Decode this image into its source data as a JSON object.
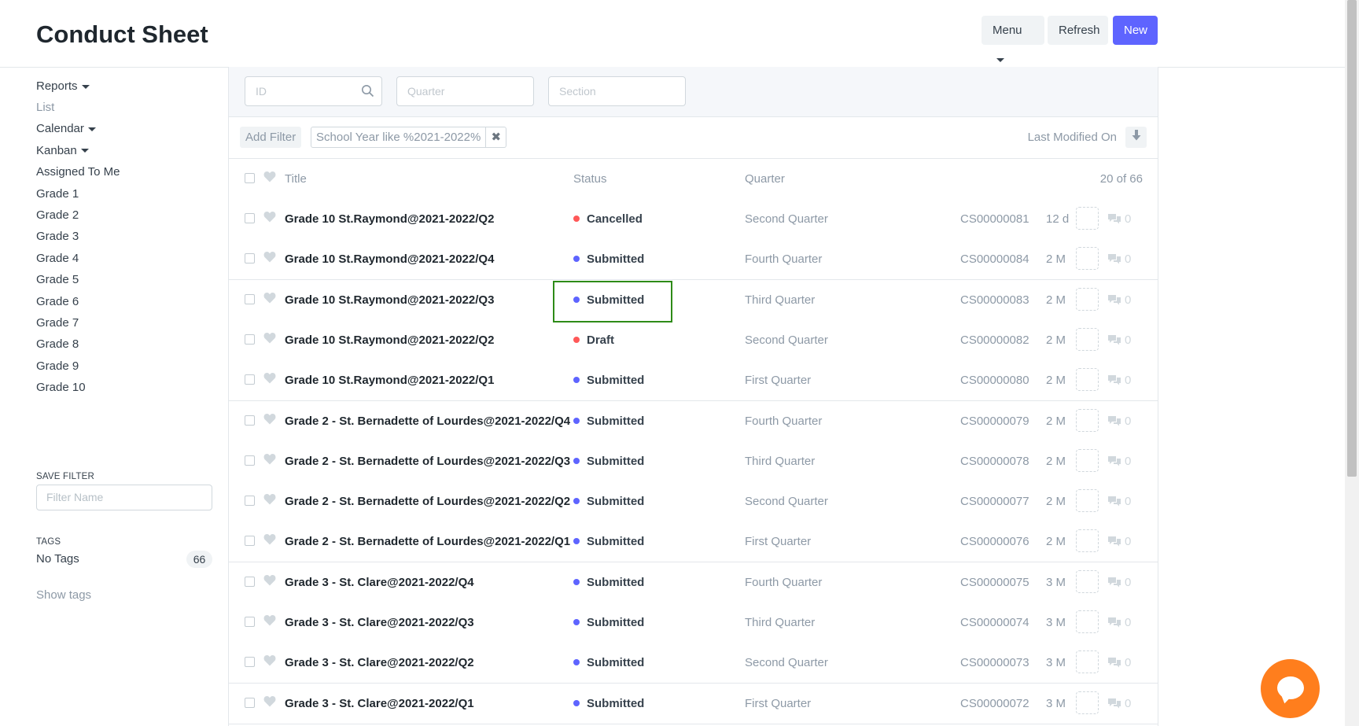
{
  "header": {
    "title": "Conduct Sheet",
    "menu_label": "Menu",
    "refresh_label": "Refresh",
    "new_label": "New"
  },
  "sidebar": {
    "items": [
      {
        "label": "Reports",
        "dropdown": true,
        "muted": false
      },
      {
        "label": "List",
        "dropdown": false,
        "muted": true
      },
      {
        "label": "Calendar",
        "dropdown": true,
        "muted": false
      },
      {
        "label": "Kanban",
        "dropdown": true,
        "muted": false
      },
      {
        "label": "Assigned To Me",
        "dropdown": false,
        "muted": false
      },
      {
        "label": "Grade 1",
        "dropdown": false,
        "muted": false
      },
      {
        "label": "Grade 2",
        "dropdown": false,
        "muted": false
      },
      {
        "label": "Grade 3",
        "dropdown": false,
        "muted": false
      },
      {
        "label": "Grade 4",
        "dropdown": false,
        "muted": false
      },
      {
        "label": "Grade 5",
        "dropdown": false,
        "muted": false
      },
      {
        "label": "Grade 6",
        "dropdown": false,
        "muted": false
      },
      {
        "label": "Grade 7",
        "dropdown": false,
        "muted": false
      },
      {
        "label": "Grade 8",
        "dropdown": false,
        "muted": false
      },
      {
        "label": "Grade 9",
        "dropdown": false,
        "muted": false
      },
      {
        "label": "Grade 10",
        "dropdown": false,
        "muted": false
      }
    ],
    "save_filter_heading": "SAVE FILTER",
    "filter_name_placeholder": "Filter Name",
    "tags_heading": "TAGS",
    "no_tags_label": "No Tags",
    "no_tags_count": "66",
    "show_tags_label": "Show tags"
  },
  "filters": {
    "id_placeholder": "ID",
    "quarter_placeholder": "Quarter",
    "section_placeholder": "Section",
    "add_filter_label": "Add Filter",
    "active_filter": "School Year like %2021-2022%",
    "sort_label": "Last Modified On"
  },
  "list_header": {
    "title": "Title",
    "status": "Status",
    "quarter": "Quarter",
    "count": "20 of 66"
  },
  "status_colors": {
    "Cancelled": "#ff5858",
    "Draft": "#ff5858",
    "Submitted": "#5e64ff"
  },
  "rows": [
    {
      "title": "Grade 10 St.Raymond@2021-2022/Q2",
      "status": "Cancelled",
      "quarter": "Second Quarter",
      "id": "CS00000081",
      "modified": "12 d",
      "comments": "0"
    },
    {
      "title": "Grade 10 St.Raymond@2021-2022/Q4",
      "status": "Submitted",
      "quarter": "Fourth Quarter",
      "id": "CS00000084",
      "modified": "2 M",
      "comments": "0"
    },
    {
      "title": "Grade 10 St.Raymond@2021-2022/Q3",
      "status": "Submitted",
      "quarter": "Third Quarter",
      "id": "CS00000083",
      "modified": "2 M",
      "comments": "0"
    },
    {
      "title": "Grade 10 St.Raymond@2021-2022/Q2",
      "status": "Draft",
      "quarter": "Second Quarter",
      "id": "CS00000082",
      "modified": "2 M",
      "comments": "0"
    },
    {
      "title": "Grade 10 St.Raymond@2021-2022/Q1",
      "status": "Submitted",
      "quarter": "First Quarter",
      "id": "CS00000080",
      "modified": "2 M",
      "comments": "0"
    },
    {
      "title": "Grade 2 - St. Bernadette of Lourdes@2021-2022/Q4",
      "status": "Submitted",
      "quarter": "Fourth Quarter",
      "id": "CS00000079",
      "modified": "2 M",
      "comments": "0"
    },
    {
      "title": "Grade 2 - St. Bernadette of Lourdes@2021-2022/Q3",
      "status": "Submitted",
      "quarter": "Third Quarter",
      "id": "CS00000078",
      "modified": "2 M",
      "comments": "0"
    },
    {
      "title": "Grade 2 - St. Bernadette of Lourdes@2021-2022/Q2",
      "status": "Submitted",
      "quarter": "Second Quarter",
      "id": "CS00000077",
      "modified": "2 M",
      "comments": "0"
    },
    {
      "title": "Grade 2 - St. Bernadette of Lourdes@2021-2022/Q1",
      "status": "Submitted",
      "quarter": "First Quarter",
      "id": "CS00000076",
      "modified": "2 M",
      "comments": "0"
    },
    {
      "title": "Grade 3 - St. Clare@2021-2022/Q4",
      "status": "Submitted",
      "quarter": "Fourth Quarter",
      "id": "CS00000075",
      "modified": "3 M",
      "comments": "0"
    },
    {
      "title": "Grade 3 - St. Clare@2021-2022/Q3",
      "status": "Submitted",
      "quarter": "Third Quarter",
      "id": "CS00000074",
      "modified": "3 M",
      "comments": "0"
    },
    {
      "title": "Grade 3 - St. Clare@2021-2022/Q2",
      "status": "Submitted",
      "quarter": "Second Quarter",
      "id": "CS00000073",
      "modified": "3 M",
      "comments": "0"
    },
    {
      "title": "Grade 3 - St. Clare@2021-2022/Q1",
      "status": "Submitted",
      "quarter": "First Quarter",
      "id": "CS00000072",
      "modified": "3 M",
      "comments": "0"
    }
  ],
  "highlighted_row_index": 2,
  "colors": {
    "accent": "#5e64ff",
    "highlight": "#2e8b18",
    "chat": "#ff7e1d"
  },
  "icons": {
    "search": "search-icon",
    "heart": "heart-icon",
    "comment": "comment-icon",
    "sort": "sort-down-icon",
    "remove": "close-icon",
    "chat": "chat-icon"
  }
}
